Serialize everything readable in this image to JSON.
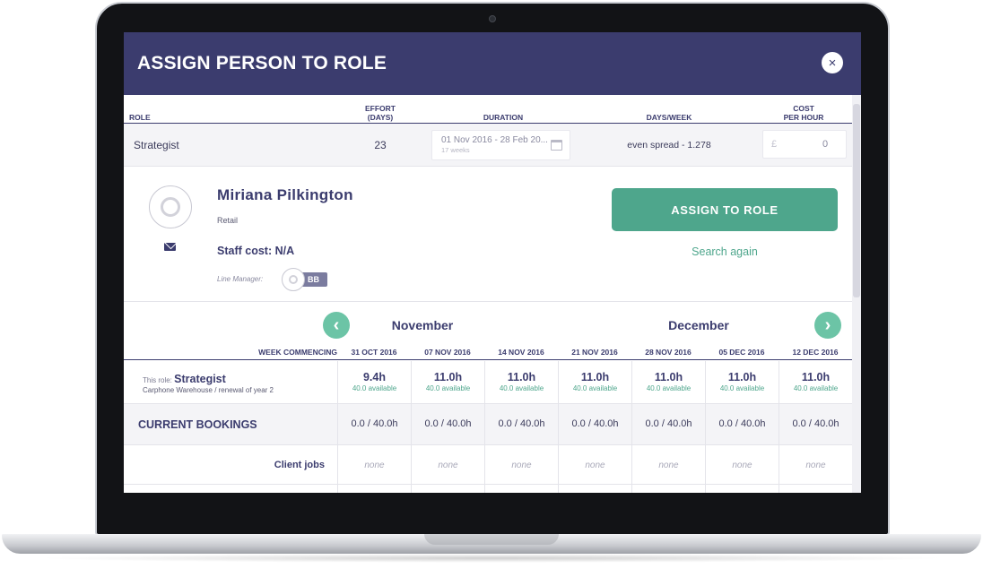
{
  "modal": {
    "title": "ASSIGN PERSON TO ROLE",
    "close_icon": "×"
  },
  "role_table": {
    "headers": {
      "role": "ROLE",
      "effort_line1": "EFFORT",
      "effort_line2": "(DAYS)",
      "duration": "DURATION",
      "days_week": "DAYS/WEEK",
      "cost_line1": "COST",
      "cost_line2": "PER HOUR"
    },
    "row": {
      "role": "Strategist",
      "effort": "23",
      "duration": "01 Nov 2016 - 28 Feb 20...",
      "duration_weeks": "17 weeks",
      "days_week": "even spread - 1.278",
      "cost_currency": "£",
      "cost_value": "0"
    }
  },
  "person": {
    "name": "Miriana Pilkington",
    "department": "Retail",
    "staff_cost": "Staff cost: N/A",
    "line_manager_label": "Line Manager:",
    "line_manager_initials": "BB",
    "assign_button": "ASSIGN TO ROLE",
    "search_again": "Search again"
  },
  "calendar": {
    "prev_icon": "‹",
    "next_icon": "›",
    "months": [
      "November",
      "December"
    ],
    "week_commencing_label": "WEEK COMMENCING",
    "weeks": [
      "31 OCT 2016",
      "07 NOV 2016",
      "14 NOV 2016",
      "21 NOV 2016",
      "28 NOV 2016",
      "05 DEC 2016",
      "12 DEC 2016"
    ],
    "this_role": {
      "prefix": "This role:",
      "role": "Strategist",
      "project": "Carphone Warehouse / renewal of year 2",
      "hours": [
        "9.4h",
        "11.0h",
        "11.0h",
        "11.0h",
        "11.0h",
        "11.0h",
        "11.0h"
      ],
      "available": [
        "40.0 available",
        "40.0 available",
        "40.0 available",
        "40.0 available",
        "40.0 available",
        "40.0 available",
        "40.0 available"
      ]
    },
    "current_bookings": {
      "label": "CURRENT BOOKINGS",
      "values": [
        "0.0 / 40.0h",
        "0.0 / 40.0h",
        "0.0 / 40.0h",
        "0.0 / 40.0h",
        "0.0 / 40.0h",
        "0.0 / 40.0h",
        "0.0 / 40.0h"
      ]
    },
    "client_jobs": {
      "label": "Client jobs",
      "values": [
        "none",
        "none",
        "none",
        "none",
        "none",
        "none",
        "none"
      ]
    }
  },
  "colors": {
    "header_bg": "#3b3c6e",
    "accent": "#4ea68c",
    "nav_button": "#6cc4a6"
  }
}
